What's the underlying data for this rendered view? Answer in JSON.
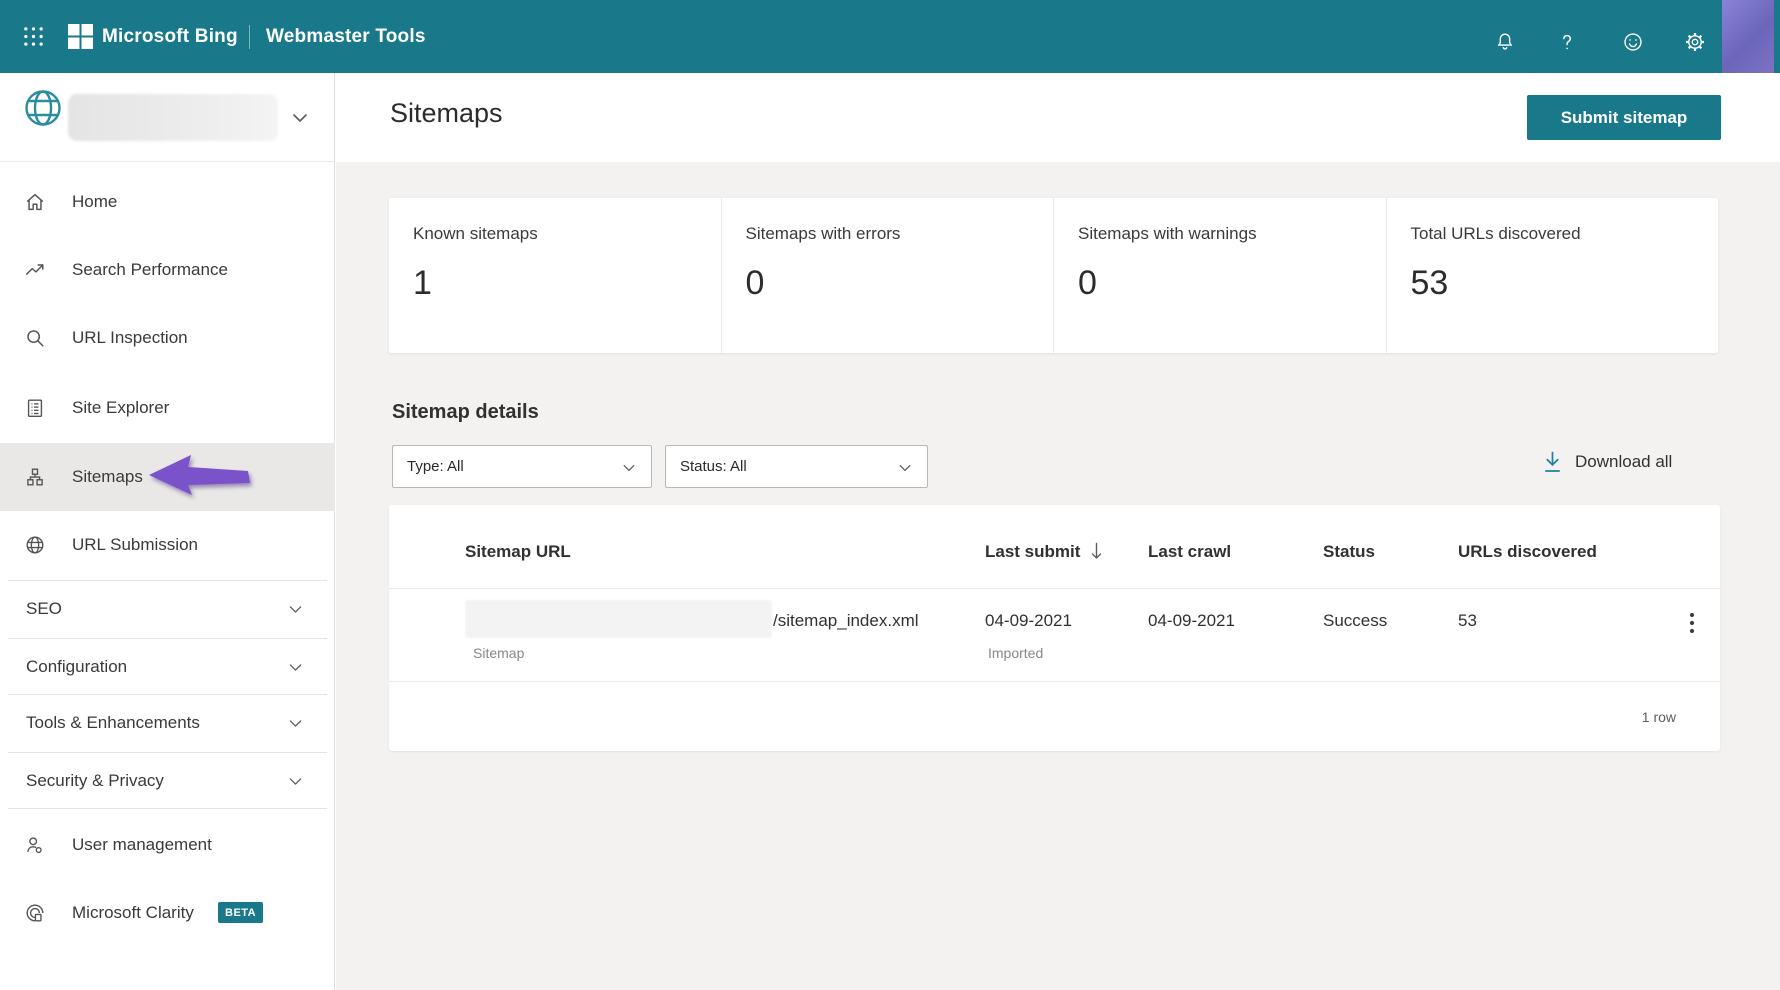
{
  "topbar": {
    "brand": "Microsoft Bing",
    "product": "Webmaster Tools"
  },
  "sidebar": {
    "nav": [
      {
        "label": "Home"
      },
      {
        "label": "Search Performance"
      },
      {
        "label": "URL Inspection"
      },
      {
        "label": "Site Explorer"
      },
      {
        "label": "Sitemaps"
      },
      {
        "label": "URL Submission"
      }
    ],
    "sections": [
      {
        "label": "SEO"
      },
      {
        "label": "Configuration"
      },
      {
        "label": "Tools & Enhancements"
      },
      {
        "label": "Security & Privacy"
      }
    ],
    "footer": [
      {
        "label": "User management"
      },
      {
        "label": "Microsoft Clarity",
        "badge": "BETA"
      }
    ]
  },
  "page": {
    "title": "Sitemaps",
    "submit_button": "Submit sitemap"
  },
  "stats": [
    {
      "label": "Known sitemaps",
      "value": "1"
    },
    {
      "label": "Sitemaps with errors",
      "value": "0"
    },
    {
      "label": "Sitemaps with warnings",
      "value": "0"
    },
    {
      "label": "Total URLs discovered",
      "value": "53"
    }
  ],
  "details": {
    "heading": "Sitemap details",
    "type_filter": "Type: All",
    "status_filter": "Status: All",
    "download_all": "Download all",
    "table": {
      "columns": [
        "Sitemap URL",
        "Last submit",
        "Last crawl",
        "Status",
        "URLs discovered"
      ],
      "row": {
        "url_suffix": "/sitemap_index.xml",
        "url_type": "Sitemap",
        "last_submit": "04-09-2021",
        "last_submit_note": "Imported",
        "last_crawl": "04-09-2021",
        "status": "Success",
        "urls_discovered": "53"
      },
      "footer": "1 row"
    }
  },
  "colors": {
    "brand_teal": "#19798a",
    "accent_purple": "#7a52c9"
  }
}
